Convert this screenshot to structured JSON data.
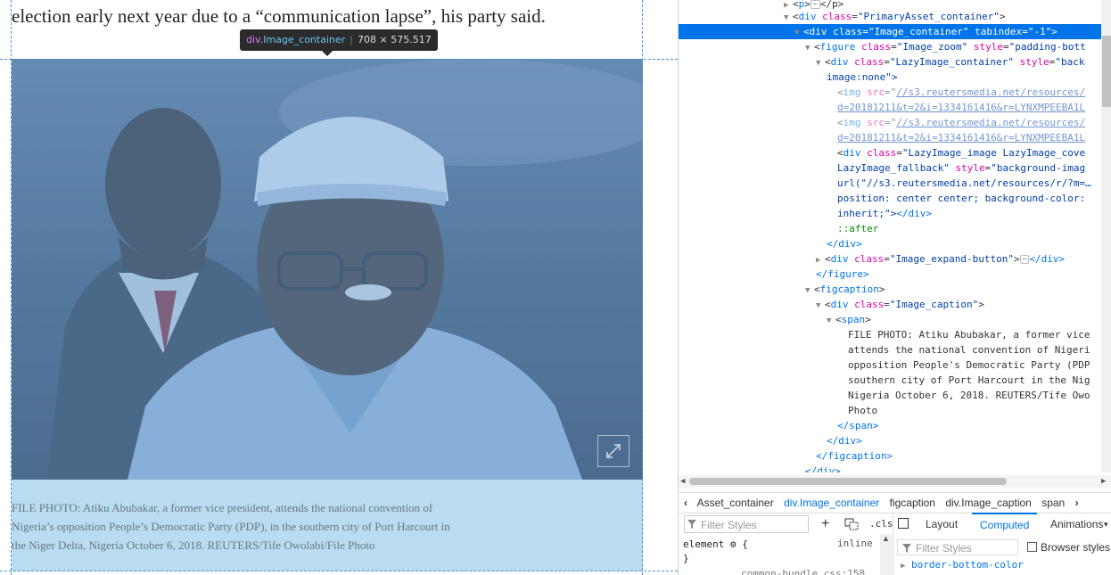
{
  "page": {
    "headline": "election early next year due to a “communication lapse”, his party said.",
    "tooltip": {
      "tag": "div",
      "cls": ".Image_container",
      "size": "708 × 575.517"
    },
    "caption": "FILE PHOTO: Atiku Abubakar, a former vice president, attends the national convention of Nigeria’s opposition People’s Democratic Party (PDP), in the southern city of Port Harcourt in the Niger Delta, Nigeria October 6, 2018. REUTERS/Tife Owolabi/File Photo"
  },
  "devtools": {
    "markup": {
      "l0": {
        "tag": "p",
        "close": "</p>"
      },
      "l1": {
        "tag": "div",
        "attr": "class",
        "val": "\"PrimaryAsset_container\"",
        "end": ">"
      },
      "l2": {
        "tag": "div",
        "attr": "class",
        "val": "\"Image_container\"",
        "attr2": "tabindex",
        "val2": "\"-1\"",
        "end": ">"
      },
      "l3": {
        "tag": "figure",
        "attr": "class",
        "val": "\"Image_zoom\"",
        "attr2": "style",
        "val2": "\"padding-bott"
      },
      "l4": {
        "tag": "div",
        "attr": "class",
        "val": "\"LazyImage_container\"",
        "attr2": "style",
        "val2": "\"back"
      },
      "l5": {
        "text": "image:none\">"
      },
      "l6": {
        "tag": "img",
        "attr": "src",
        "val": "//s3.reutersmedia.net/resources/"
      },
      "l7": {
        "text": "d=20181211&t=2&i=1334161416&r=LYNXMPEEBA1L"
      },
      "l8": {
        "tag": "img",
        "attr": "src",
        "val": "//s3.reutersmedia.net/resources/"
      },
      "l9": {
        "text": "d=20181211&t=2&i=1334161416&r=LYNXMPEEBA1L"
      },
      "l10": {
        "tag": "div",
        "attr": "class",
        "val": "\"LazyImage_image LazyImage_cove"
      },
      "l11": {
        "text": "LazyImage_fallback\"",
        "attr2": "style",
        "val2": "\"background-imag"
      },
      "l12": {
        "text": "url(\"//s3.reutersmedia.net/resources/r/?m=…"
      },
      "l13": {
        "text": "position: center center; background-color:"
      },
      "l14": {
        "text": "inherit;\">",
        "close": "</div>"
      },
      "l15": {
        "text": "::after"
      },
      "l16": {
        "close": "</div>"
      },
      "l17": {
        "tag": "div",
        "attr": "class",
        "val": "\"Image_expand-button\"",
        "close": "</div>"
      },
      "l18": {
        "close": "</figure>"
      },
      "l19": {
        "tag": "figcaption"
      },
      "l20": {
        "tag": "div",
        "attr": "class",
        "val": "\"Image_caption\""
      },
      "l21": {
        "tag": "span"
      },
      "l22": {
        "text": "FILE PHOTO: Atiku Abubakar, a former vice"
      },
      "l23": {
        "text": "attends the national convention of Nigeri"
      },
      "l24": {
        "text": "opposition People's Democratic Party (PDP"
      },
      "l25": {
        "text": "southern city of Port Harcourt in the Nig"
      },
      "l26": {
        "text": "Nigeria October 6, 2018. REUTERS/Tife Owo"
      },
      "l27": {
        "text": "Photo"
      },
      "l28": {
        "close": "</span>"
      },
      "l29": {
        "close": "</div>"
      },
      "l30": {
        "close": "</figcaption>"
      },
      "l31": {
        "close": "</div>"
      }
    },
    "breadcrumbs": [
      "Asset_container",
      "div.Image_container",
      "figcaption",
      "div.Image_caption",
      "span"
    ],
    "rules": {
      "filter_placeholder": "Filter Styles",
      "add": "+",
      "cls": ".cls",
      "element_rule": "element",
      "brace_open": "{",
      "brace_close": "}",
      "inline": "inline",
      "common_css": "common-bundle.css:158"
    },
    "computed": {
      "tabs": [
        "Layout",
        "Computed",
        "Animations"
      ],
      "active_tab": "Computed",
      "filter_placeholder": "Filter Styles",
      "browser_styles": "Browser styles",
      "first_prop": "border-bottom-color"
    }
  }
}
